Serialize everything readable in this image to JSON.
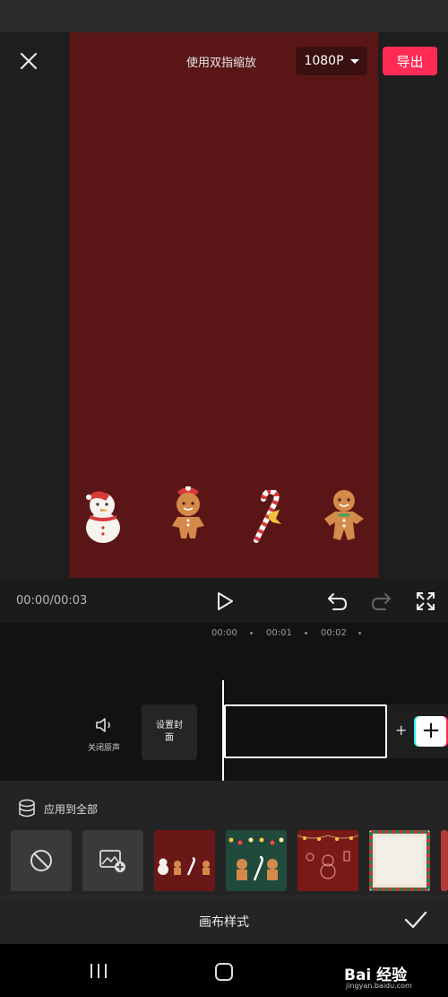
{
  "header": {
    "hint": "使用双指缩放",
    "resolution": "1080P",
    "export_label": "导出"
  },
  "player": {
    "time": "00:00/00:03"
  },
  "timeline": {
    "ticks": [
      "00:00",
      "00:01",
      "00:02"
    ],
    "mute_label": "关闭原声",
    "cover_label": "设置封面"
  },
  "panel": {
    "apply_all_label": "应用到全部",
    "title": "画布样式",
    "styles": [
      "none",
      "custom-image",
      "red-gingerbread",
      "green-lights",
      "red-outline-doodles",
      "candy-stripe-frame",
      "stripe-partial"
    ]
  },
  "stickers": [
    "snowman",
    "gingerbread-girl",
    "candy-cane",
    "gingerbread-man"
  ],
  "colors": {
    "canvas_bg": "#5a1616",
    "export": "#fe2c55",
    "accent_cyan": "#25f4ee"
  },
  "watermark": {
    "logo": "Bai 经验",
    "url": "jingyan.baidu.com"
  }
}
